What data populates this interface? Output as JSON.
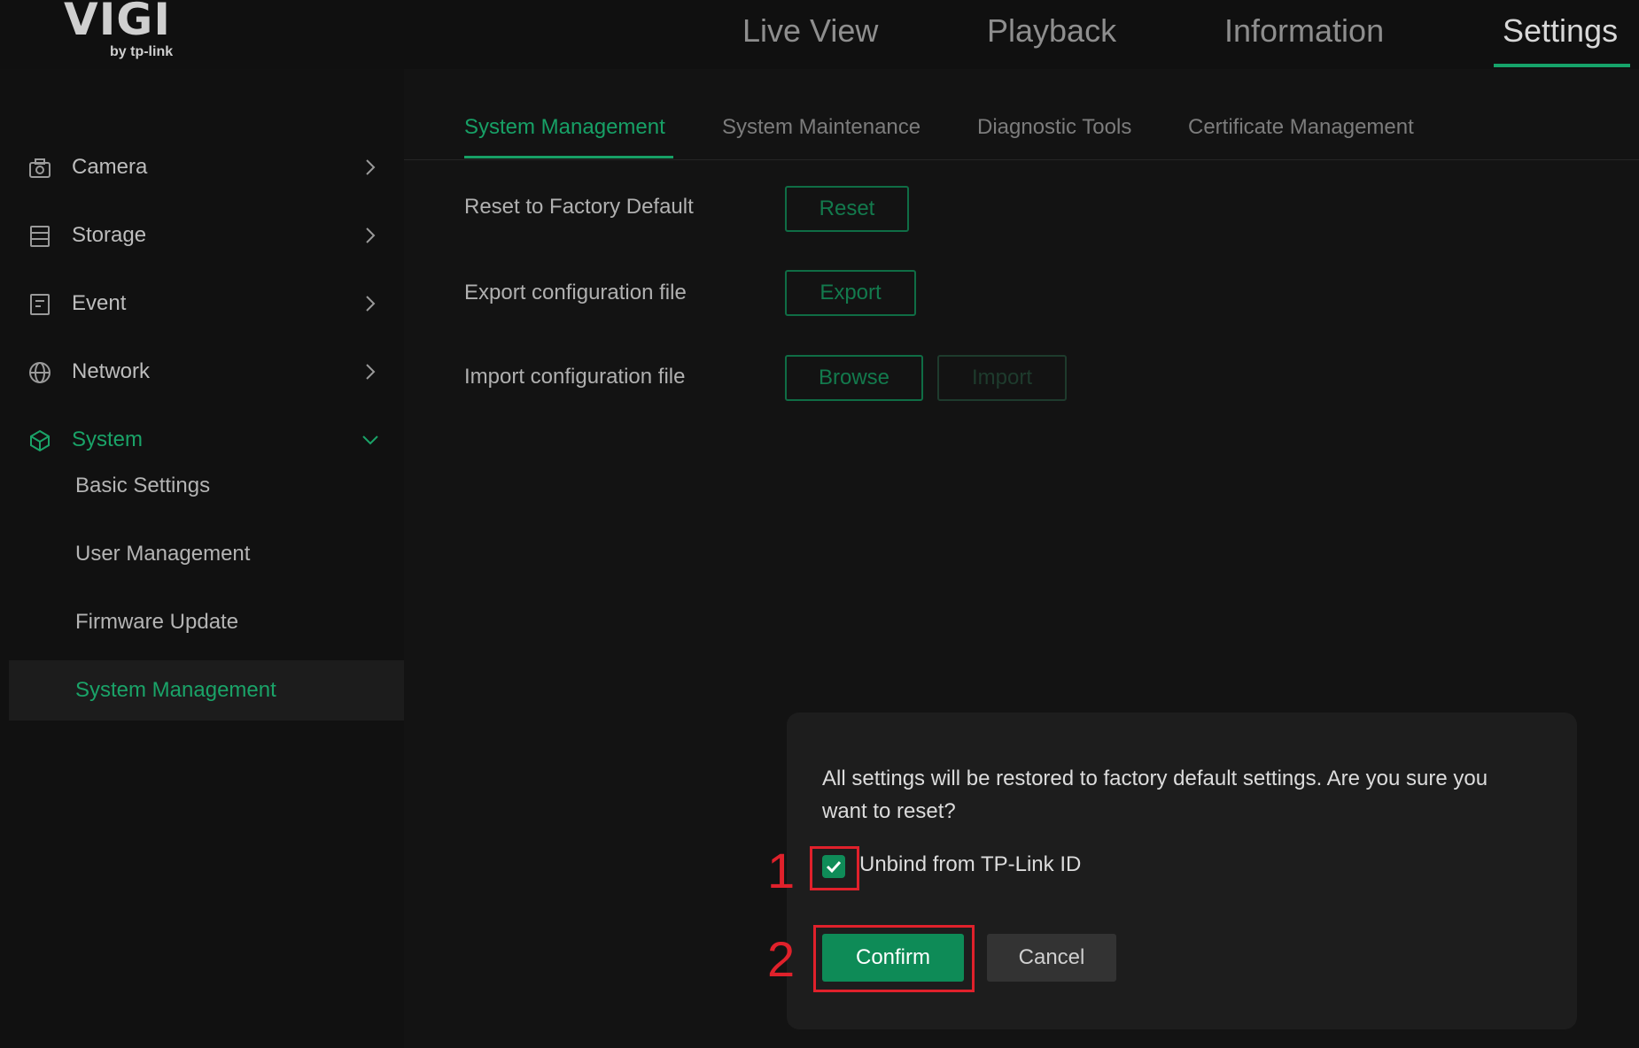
{
  "brand": {
    "logo_text": "VIGI",
    "logo_sub": "by tp-link"
  },
  "top_nav": {
    "tabs": [
      "Live View",
      "Playback",
      "Information",
      "Settings"
    ],
    "active": "Settings"
  },
  "sidebar": {
    "items": [
      {
        "label": "Camera",
        "icon": "camera-icon",
        "expanded": false
      },
      {
        "label": "Storage",
        "icon": "storage-icon",
        "expanded": false
      },
      {
        "label": "Event",
        "icon": "event-icon",
        "expanded": false
      },
      {
        "label": "Network",
        "icon": "globe-icon",
        "expanded": false
      },
      {
        "label": "System",
        "icon": "system-icon",
        "expanded": true
      }
    ],
    "sub_items": [
      "Basic Settings",
      "User Management",
      "Firmware Update",
      "System Management"
    ],
    "active_sub": "System Management"
  },
  "subtabs": {
    "tabs": [
      "System Management",
      "System Maintenance",
      "Diagnostic Tools",
      "Certificate Management"
    ],
    "active": "System Management"
  },
  "settings_rows": {
    "reset_label": "Reset to Factory Default",
    "reset_button": "Reset",
    "export_label": "Export configuration file",
    "export_button": "Export",
    "import_label": "Import configuration file",
    "browse_button": "Browse",
    "import_button": "Import"
  },
  "dialog": {
    "message": "All settings will be restored to factory default settings. Are you sure you want to reset?",
    "checkbox_label": "Unbind from TP-Link ID",
    "checkbox_checked": true,
    "confirm_label": "Confirm",
    "cancel_label": "Cancel"
  },
  "annotations": {
    "step1": "1",
    "step2": "2"
  },
  "colors": {
    "accent": "#16a36a",
    "annotation": "#e0212b",
    "background": "#131313"
  }
}
